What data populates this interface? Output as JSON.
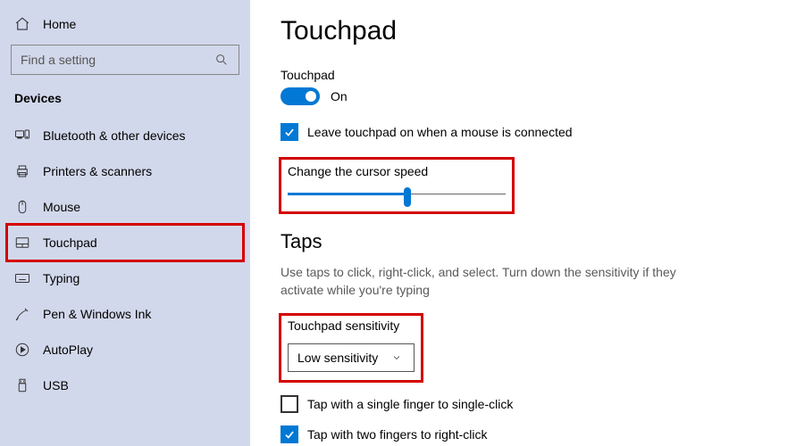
{
  "sidebar": {
    "home": "Home",
    "search_placeholder": "Find a setting",
    "section": "Devices",
    "items": [
      {
        "label": "Bluetooth & other devices"
      },
      {
        "label": "Printers & scanners"
      },
      {
        "label": "Mouse"
      },
      {
        "label": "Touchpad"
      },
      {
        "label": "Typing"
      },
      {
        "label": "Pen & Windows Ink"
      },
      {
        "label": "AutoPlay"
      },
      {
        "label": "USB"
      }
    ]
  },
  "main": {
    "title": "Touchpad",
    "touchpad_label": "Touchpad",
    "toggle_state": "On",
    "leave_on_label": "Leave touchpad on when a mouse is connected",
    "cursor_speed_label": "Change the cursor speed",
    "slider_percent": 55,
    "taps_heading": "Taps",
    "taps_desc": "Use taps to click, right-click, and select. Turn down the sensitivity if they activate while you're typing",
    "sensitivity_label": "Touchpad sensitivity",
    "sensitivity_value": "Low sensitivity",
    "tap_single": "Tap with a single finger to single-click",
    "tap_double": "Tap with two fingers to right-click"
  }
}
